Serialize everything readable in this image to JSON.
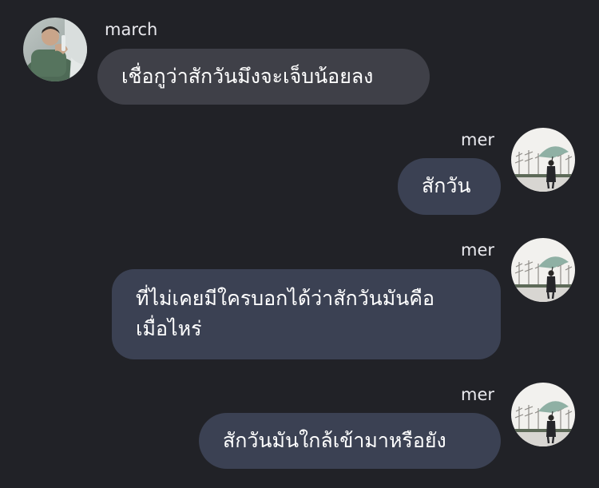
{
  "messages": [
    {
      "direction": "incoming",
      "sender": "march",
      "avatar_icon": "profile-photo-man-green-shirt",
      "lines": [
        "เชื่อกูว่าสักวันมึงจะเจ็บน้อยลง"
      ]
    },
    {
      "direction": "outgoing",
      "sender": "mer",
      "avatar_icon": "profile-photo-person-umbrella",
      "lines": [
        "สักวัน"
      ]
    },
    {
      "direction": "outgoing",
      "sender": "mer",
      "avatar_icon": "profile-photo-person-umbrella",
      "lines": [
        "ที่ไม่เคยมีใครบอกได้ว่าสักวันมันคือ",
        "เมื่อไหร่"
      ]
    },
    {
      "direction": "outgoing",
      "sender": "mer",
      "avatar_icon": "profile-photo-person-umbrella",
      "lines": [
        "สักวันมันใกล้เข้ามาหรือยัง"
      ]
    }
  ],
  "colors": {
    "background": "#212227",
    "incoming_bubble": "#3f4048",
    "outgoing_bubble": "#3b4153",
    "text": "#ffffff"
  }
}
